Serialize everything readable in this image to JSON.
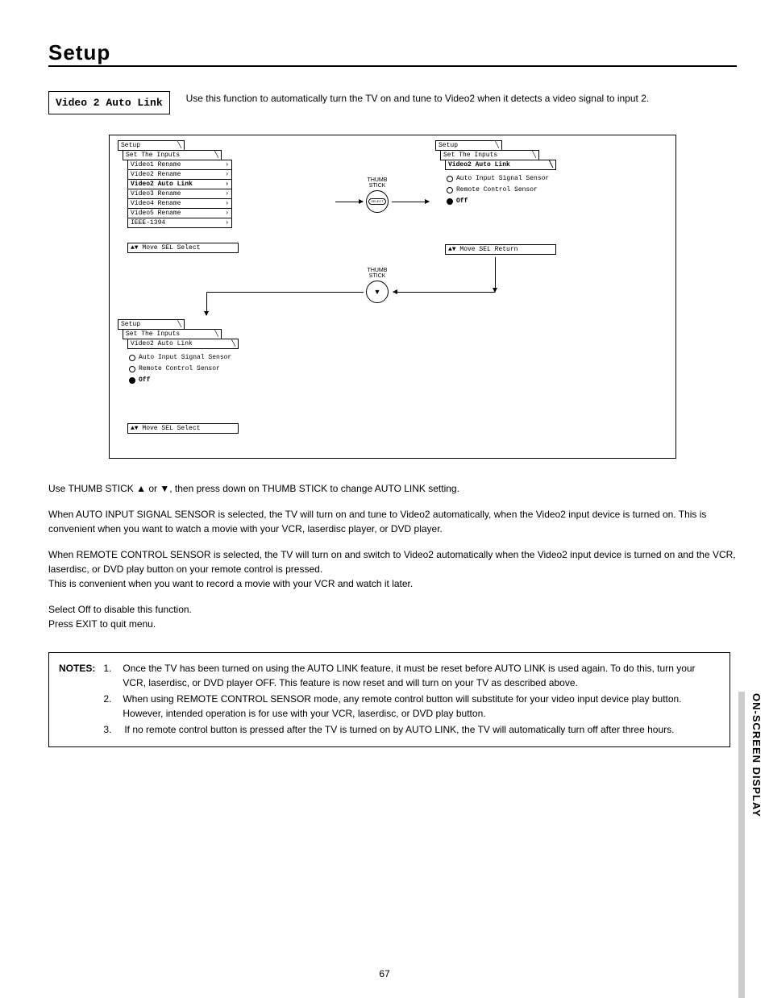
{
  "page": {
    "title": "Setup",
    "number": "67",
    "sideTab": "ON-SCREEN DISPLAY"
  },
  "feature": {
    "name": "Video 2 Auto Link",
    "intro": "Use this function to automatically turn the TV on and tune to Video2 when it detects a video signal to input 2."
  },
  "thumbstick": {
    "label": "THUMB\nSTICK",
    "select": "SELECT"
  },
  "osd1": {
    "crumbs": [
      "Setup",
      "Set The Inputs"
    ],
    "items": [
      "Video1 Rename",
      "Video2 Rename",
      "Video2 Auto Link",
      "Video3 Rename",
      "Video4 Rename",
      "Video5 Rename",
      "IEEE-1394"
    ],
    "selectedIndex": 2,
    "footer": "▲▼ Move  SEL Select"
  },
  "osd2": {
    "crumbs": [
      "Setup",
      "Set The Inputs",
      "Video2 Auto Link"
    ],
    "options": [
      "Auto Input Signal Sensor",
      "Remote Control Sensor",
      "Off"
    ],
    "selectedIndex": 2,
    "footer": "▲▼ Move  SEL Return"
  },
  "osd3": {
    "crumbs": [
      "Setup",
      "Set The Inputs",
      "Video2 Auto Link"
    ],
    "options": [
      "Auto Input Signal Sensor",
      "Remote Control Sensor",
      "Off"
    ],
    "selectedIndex": 2,
    "footer": "▲▼ Move  SEL Select"
  },
  "body": {
    "p1": "Use THUMB STICK ▲ or ▼, then press down on THUMB STICK to change AUTO LINK setting.",
    "p2": "When AUTO INPUT SIGNAL SENSOR is selected, the TV will turn on and tune to Video2 automatically, when the Video2 input device is turned on. This is convenient when you want to watch a movie with your VCR, laserdisc player, or DVD player.",
    "p3": "When REMOTE CONTROL SENSOR is selected, the TV will turn on and switch to Video2 automatically when the Video2 input device is turned on and the VCR, laserdisc, or DVD play button on your remote control is pressed.\nThis is convenient when you want to record a movie with your VCR and watch it later.",
    "p4": "Select Off to disable this function.\nPress EXIT to quit menu."
  },
  "notes": {
    "label": "NOTES:",
    "items": [
      "Once the TV has been turned on using the AUTO LINK feature, it must be reset before AUTO LINK is used again. To do this, turn your VCR, laserdisc, or DVD player OFF. This feature is now reset and will turn on your TV as described above.",
      "When using REMOTE CONTROL SENSOR mode, any remote control button will substitute for your video input device play button. However, intended operation is for use with your VCR, laserdisc, or DVD play button.",
      "If no remote control button is pressed after the TV is turned on by AUTO LINK, the TV will automatically turn off after three hours."
    ]
  }
}
